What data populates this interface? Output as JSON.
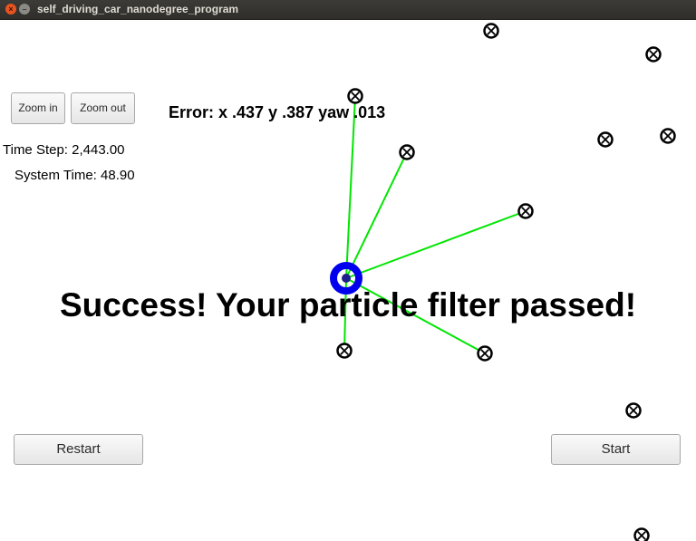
{
  "window": {
    "title": "self_driving_car_nanodegree_program",
    "close_glyph": "×",
    "minimize_glyph": "–"
  },
  "controls": {
    "zoom_in": "Zoom in",
    "zoom_out": "Zoom out",
    "restart": "Restart",
    "start": "Start"
  },
  "status": {
    "time_step": "Time Step: 2,443.00",
    "system_time": "System Time: 48.90",
    "error": "Error: x .437 y .387 yaw .013",
    "success_message": "Success! Your particle filter passed!"
  },
  "colors": {
    "observation_line": "#00e600",
    "vehicle": "#0000ee",
    "landmark": "#000000"
  },
  "icons": {
    "landmark": "landmark-marker-icon",
    "vehicle": "vehicle-particle-icon"
  }
}
